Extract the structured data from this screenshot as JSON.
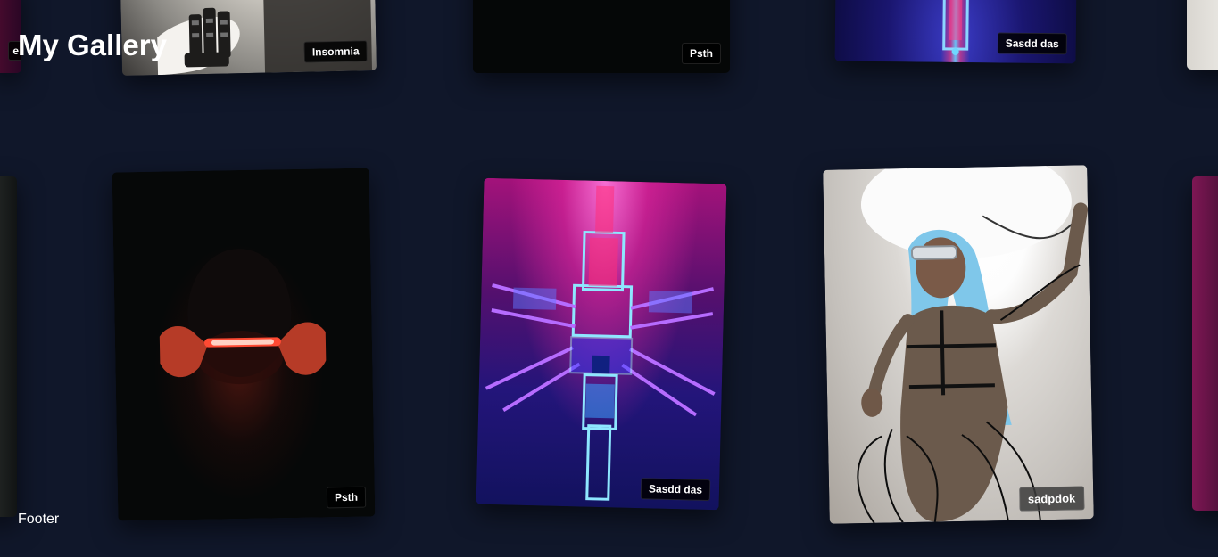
{
  "page": {
    "title": "My Gallery",
    "footer": "Footer"
  },
  "gallery": {
    "cards": [
      {
        "tag": "e",
        "image": "partial gallery image"
      },
      {
        "tag": "Insomnia",
        "image": "monochrome portrait with robotic hand"
      },
      {
        "tag": "Psth",
        "image": "dark image"
      },
      {
        "tag": "Sasdd das",
        "image": "neon geometric structure"
      },
      {
        "tag": "",
        "image": "partial light image"
      },
      {
        "tag": "",
        "image": "partial dark portrait"
      },
      {
        "tag": "Psth",
        "image": "person holding red neon light"
      },
      {
        "tag": "Sasdd das",
        "image": "neon crystal cross structure"
      },
      {
        "tag": "sadpdok",
        "image": "person with blue hair and visor"
      },
      {
        "tag": "",
        "image": "partial pink neon image"
      }
    ]
  },
  "colors": {
    "background": "#10172a",
    "tag_background": "#000000",
    "tag_text": "#ffffff",
    "title_text": "#ffffff"
  }
}
